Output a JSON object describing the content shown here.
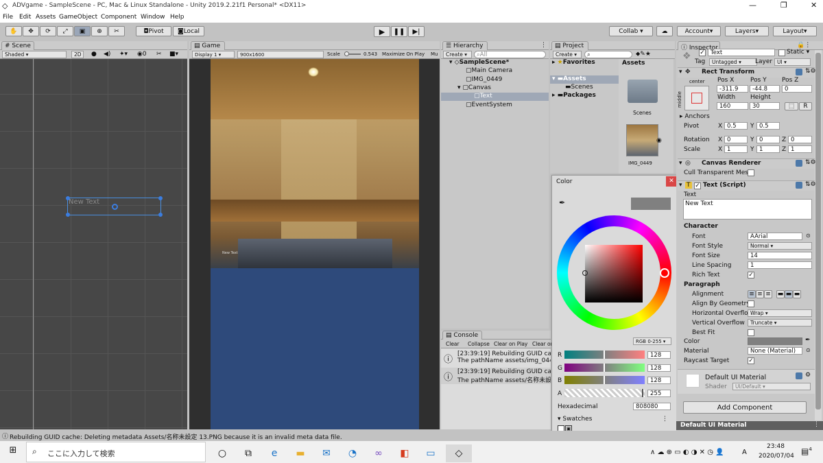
{
  "window": {
    "title": "ADVgame - SampleScene - PC, Mac & Linux Standalone - Unity 2019.2.21f1 Personal* <DX11>",
    "menu": [
      "File",
      "Edit",
      "Assets",
      "GameObject",
      "Component",
      "Window",
      "Help"
    ]
  },
  "toolbar": {
    "pivot": "Pivot",
    "local": "Local",
    "collab": "Collab ▾",
    "account": "Account",
    "layers": "Layers",
    "layout": "Layout"
  },
  "scene": {
    "tab": "Scene",
    "shading": "Shaded",
    "mode2d": "2D",
    "gizmo_count": "0",
    "text_label": "New Text"
  },
  "game": {
    "tab": "Game",
    "display": "Display 1",
    "resolution": "900x1600",
    "scale_label": "Scale",
    "scale_value": "0.543",
    "maximize": "Maximize On Play",
    "mute": "Mu",
    "small_text": "New Text"
  },
  "hierarchy": {
    "tab": "Hierarchy",
    "create": "Create ▾",
    "search_placeholder": "All",
    "items": [
      "SampleScene*",
      "Main Camera",
      "IMG_0449",
      "Canvas",
      "Text",
      "EventSystem"
    ]
  },
  "project": {
    "tab": "Project",
    "create": "Create ▾",
    "tree": [
      "Favorites",
      "Assets",
      "Scenes",
      "Packages"
    ],
    "breadcrumb": "Assets",
    "assets": [
      "Scenes",
      "IMG_0449"
    ]
  },
  "console": {
    "tab": "Console",
    "buttons": [
      "Clear",
      "Collapse",
      "Clear on Play",
      "Clear or"
    ],
    "logs": [
      {
        "l1": "[23:39:19] Rebuilding GUID cac",
        "l2": "The pathName assets/img_044"
      },
      {
        "l1": "[23:39:19] Rebuilding GUID cac",
        "l2": "The pathName assets/名称未設定"
      }
    ]
  },
  "color": {
    "title": "Color",
    "mode": "RGB 0-255 ▾",
    "channels": [
      {
        "label": "R",
        "value": "128"
      },
      {
        "label": "G",
        "value": "128"
      },
      {
        "label": "B",
        "value": "128"
      },
      {
        "label": "A",
        "value": "255"
      }
    ],
    "hex_label": "Hexadecimal",
    "hex": "808080",
    "swatches": "Swatches",
    "swatch_color": "#808080"
  },
  "inspector": {
    "tab": "Inspector",
    "obj_name": "Text",
    "static": "Static ▾",
    "tag_label": "Tag",
    "tag": "Untagged",
    "layer_label": "Layer",
    "layer": "UI",
    "rect_title": "Rect Transform",
    "anchor_preset": "center",
    "middle": "middle",
    "pos_labels": [
      "Pos X",
      "Pos Y",
      "Pos Z"
    ],
    "pos": [
      "-311.9",
      "-44.8",
      "0"
    ],
    "size_labels": [
      "Width",
      "Height"
    ],
    "size": [
      "160",
      "30"
    ],
    "r_btn": "R",
    "anchors": "Anchors",
    "pivot_label": "Pivot",
    "pivot": [
      "0.5",
      "0.5"
    ],
    "rotation_label": "Rotation",
    "rotation": [
      "0",
      "0",
      "0"
    ],
    "scale_label": "Scale",
    "scale": [
      "1",
      "1",
      "1"
    ],
    "axes": [
      "X",
      "Y",
      "Z"
    ],
    "canvas_renderer": "Canvas Renderer",
    "cull": "Cull Transparent Mes",
    "text_script": "Text (Script)",
    "text_label": "Text",
    "text_value": "New Text",
    "character": "Character",
    "font_label": "Font",
    "font": "Arial",
    "font_style_label": "Font Style",
    "font_style": "Normal",
    "font_size_label": "Font Size",
    "font_size": "14",
    "line_spacing_label": "Line Spacing",
    "line_spacing": "1",
    "rich_text": "Rich Text",
    "paragraph": "Paragraph",
    "alignment": "Alignment",
    "align_geom": "Align By Geometry",
    "h_overflow_label": "Horizontal Overflo",
    "h_overflow": "Wrap",
    "v_overflow_label": "Vertical Overflow",
    "v_overflow": "Truncate",
    "best_fit": "Best Fit",
    "color_label": "Color",
    "material_label": "Material",
    "material": "None (Material)",
    "raycast": "Raycast Target",
    "default_mat": "Default UI Material",
    "shader_label": "Shader",
    "shader": "UI/Default",
    "add_component": "Add Component",
    "footer": "Default UI Material"
  },
  "status": "Rebuilding GUID cache: Deleting metadata Assets/名称未設定 13.PNG because it is an invalid meta data file.",
  "taskbar": {
    "search": "ここに入力して検索",
    "time": "23:48",
    "date": "2020/07/04",
    "ime": "A",
    "notif": "4"
  }
}
